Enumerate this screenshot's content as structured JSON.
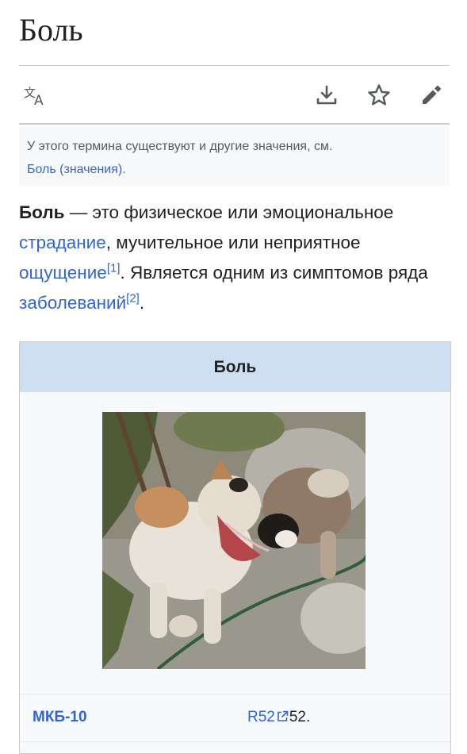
{
  "article": {
    "title": "Боль",
    "hatnote_text": "У этого термина существуют и другие значения, см. ",
    "hatnote_link": "Боль (значения)",
    "hatnote_end": "."
  },
  "toolbar": {
    "icons": [
      "language-icon",
      "download-icon",
      "star-icon",
      "edit-pencil-icon"
    ]
  },
  "lead": {
    "term": "Боль",
    "t1": " — это физическое или эмоциональное ",
    "link1": "страдание",
    "t2": ", мучительное или неприятное ",
    "link2": "ощущение",
    "ref1": "[1]",
    "t3": ". Является одним из симптомов ряда ",
    "link3": "заболеваний",
    "ref2": "[2]",
    "t4": "."
  },
  "infobox": {
    "header": "Боль",
    "image_alt": "Две собаки, одна кусает другую",
    "row_label": "МКБ-10",
    "row_value_link": "R52",
    "row_value_text": "52."
  },
  "colors": {
    "link": "#3366cc",
    "text": "#202122",
    "infobox_header": "#cedff2",
    "hatnote_bg": "#f8f9fa"
  }
}
